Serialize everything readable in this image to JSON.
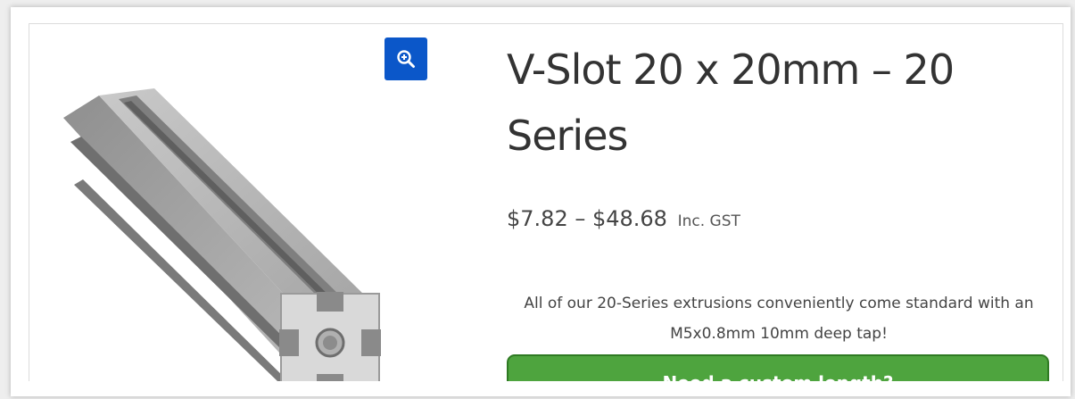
{
  "product": {
    "title": "V-Slot 20 x 20mm – 20 Series",
    "price_range": "$7.82 – $48.68",
    "price_suffix": "Inc. GST",
    "description": "All of our 20-Series extrusions conveniently come standard with an M5x0.8mm 10mm deep tap!",
    "cta_heading": "Need a custom length?"
  },
  "gallery": {
    "zoom_icon": "zoom-in-icon",
    "image": "aluminium-extrusion-image"
  },
  "colors": {
    "zoom_button": "#0b57c9",
    "cta_background": "#4ea43e",
    "cta_border": "#2f7a23",
    "title_text": "#333333"
  }
}
